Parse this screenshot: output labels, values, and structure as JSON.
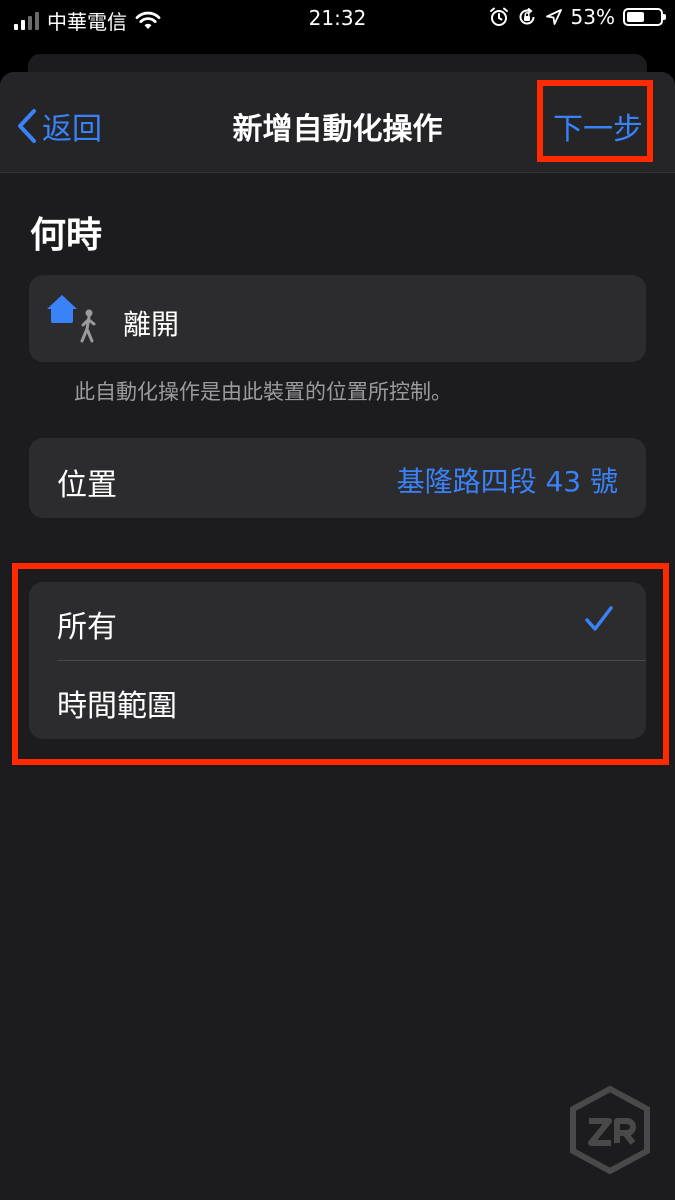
{
  "status_bar": {
    "carrier": "中華電信",
    "time": "21:32",
    "battery_percent": "53%",
    "battery_level": 0.53
  },
  "navbar": {
    "back_label": "返回",
    "title": "新增自動化操作",
    "next_label": "下一步"
  },
  "section": {
    "title": "何時"
  },
  "trigger": {
    "label": "離開",
    "icon": "home-leave-icon"
  },
  "footnote": "此自動化操作是由此裝置的位置所控制。",
  "location": {
    "label": "位置",
    "value": "基隆路四段 43 號"
  },
  "options": {
    "items": [
      {
        "label": "所有",
        "selected": true
      },
      {
        "label": "時間範圍",
        "selected": false
      }
    ]
  },
  "colors": {
    "accent": "#3a82f7",
    "highlight": "#ff2a00",
    "background": "#1c1c1e",
    "cell": "#2c2c2e"
  }
}
